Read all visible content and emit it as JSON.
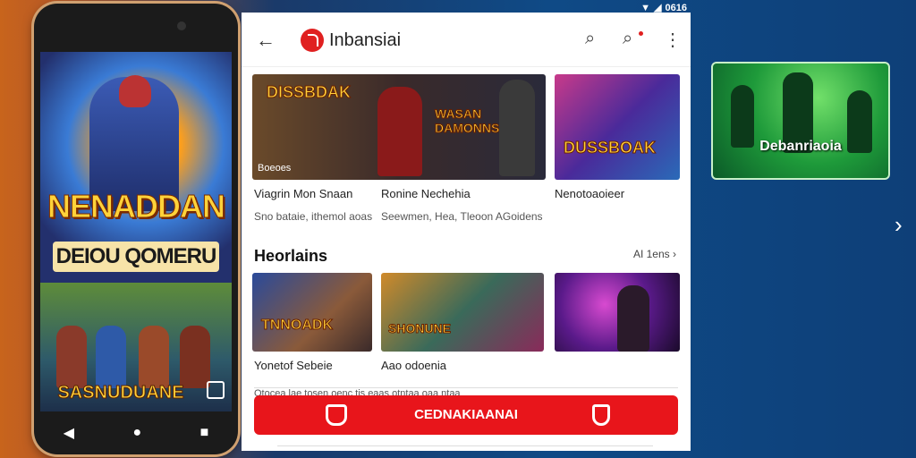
{
  "status": {
    "time": "0616"
  },
  "phone": {
    "title": "NENADDAN",
    "subtitle": "DEIOU QOMERU",
    "second_title": "SASNUDUANE"
  },
  "panel": {
    "app_title": "Inbansiai",
    "featured": [
      {
        "overlay": "DISSBDAK",
        "badge": "Boeoes",
        "caption": "Viagrin Mon Snaan",
        "sub": "Sno bataie, ithemol aoas"
      },
      {
        "overlay": "WASAN DAMONNS",
        "caption": "Ronine Nechehia",
        "sub": "Seewmen, Hea, Tleoon AGoidens"
      },
      {
        "overlay": "DUSSBOAK",
        "caption": "Nenotoaoieer",
        "sub": ""
      }
    ],
    "section_title": "Heorlains",
    "section_more": "AI 1ens",
    "row2": [
      {
        "overlay": "TNNOADK",
        "caption": "Yonetof Sebeie"
      },
      {
        "overlay": "SHONUNE",
        "caption": "Aao odoenia"
      },
      {
        "overlay": "",
        "caption": ""
      }
    ],
    "promo_text": "Otocea lae tosen oenc tis eaas otntaa oaa ntaa",
    "cta_label": "CEDNAKIAANAI"
  },
  "side_thumb": {
    "label": "Debanriaoia"
  },
  "colors": {
    "accent": "#e8151b",
    "thumb_green": "#1e9a3a"
  }
}
